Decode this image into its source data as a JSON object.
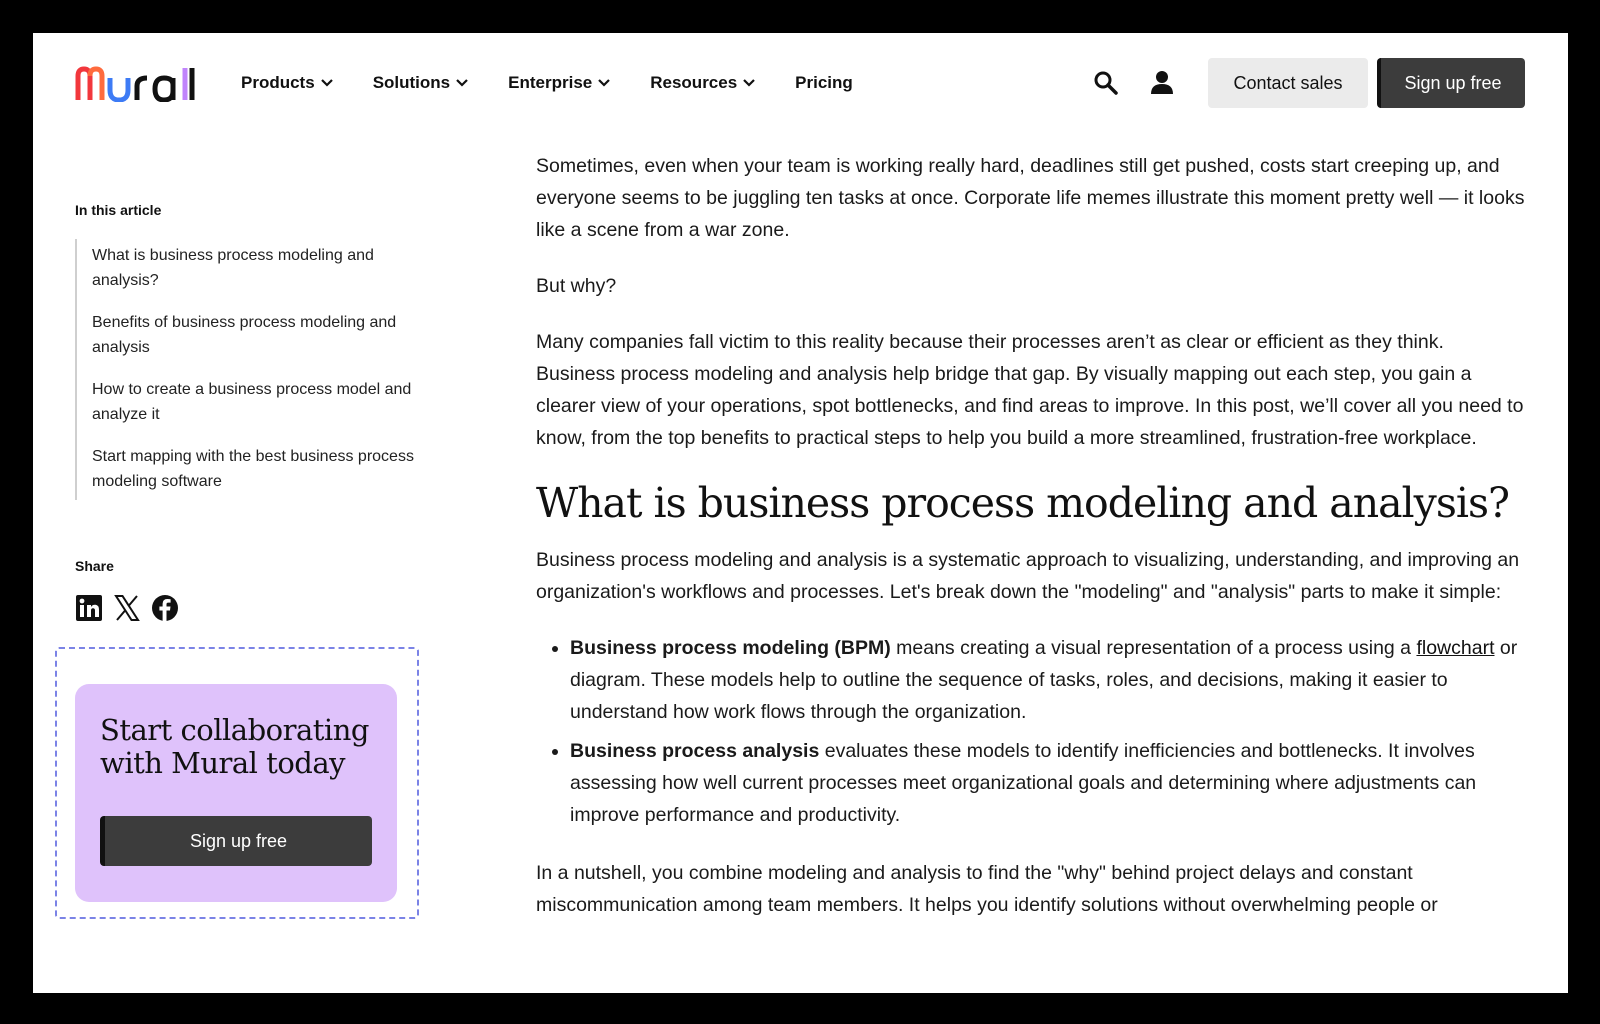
{
  "header": {
    "logo_text": "Mural",
    "nav": [
      {
        "label": "Products",
        "has_dropdown": true
      },
      {
        "label": "Solutions",
        "has_dropdown": true
      },
      {
        "label": "Enterprise",
        "has_dropdown": true
      },
      {
        "label": "Resources",
        "has_dropdown": true
      },
      {
        "label": "Pricing",
        "has_dropdown": false
      }
    ],
    "search_icon": "search-icon",
    "account_icon": "user-icon",
    "contact_label": "Contact sales",
    "signup_label": "Sign up free"
  },
  "sidebar": {
    "toc_title": "In this article",
    "toc_items": [
      "What is business process modeling and analysis?",
      "Benefits of business process modeling and analysis",
      "How to create a business process model and analyze it",
      "Start mapping with the best business process modeling software"
    ],
    "share_title": "Share",
    "share_icons": [
      "linkedin-icon",
      "x-icon",
      "facebook-icon"
    ],
    "cta": {
      "title": "Start collaborating with Mural today",
      "button_label": "Sign up free"
    }
  },
  "article": {
    "intro_1": "Sometimes, even when your team is working really hard, deadlines still get pushed, costs start creeping up, and everyone seems to be juggling ten tasks at once. Corporate life memes illustrate this moment pretty well — it looks like a scene from a war zone.",
    "intro_2": "But why?",
    "intro_3": "Many companies fall victim to this reality because their processes aren’t as clear or efficient as they think. Business process modeling and analysis help bridge that gap. By visually mapping out each step, you gain a clearer view of your operations, spot bottlenecks, and find areas to improve. In this post, we’ll cover all you need to know, from the top benefits to practical steps to help you build a more streamlined, frustration-free workplace.",
    "heading": "What is business process modeling and analysis?",
    "definition": "Business process modeling and analysis is a systematic approach to visualizing, understanding, and improving an organization's workflows and processes. Let's break down the \"modeling\" and \"analysis\" parts to make it simple:",
    "bullet_1_bold": "Business process modeling (BPM)",
    "bullet_1_text": " means creating a visual representation of a process using a ",
    "bullet_1_link": "flowchart",
    "bullet_1_rest": " or diagram. These models help to outline the sequence of tasks, roles, and decisions, making it easier to understand how work flows through the organization.",
    "bullet_2_bold": "Business process analysis",
    "bullet_2_text": " evaluates these models to identify inefficiencies and bottlenecks. It involves assessing how well current processes meet organizational goals and determining where adjustments can improve performance and productivity.",
    "nutshell": "In a nutshell, you combine modeling and analysis to find the \"why\" behind project delays and constant miscommunication among team members. It helps you identify solutions without overwhelming people or"
  },
  "colors": {
    "page_bg": "#ffffff",
    "frame": "#000000",
    "dark_button": "#3c3c3c",
    "light_button": "#ebebeb",
    "cta_bg": "#dfc2fb",
    "cta_border": "#7b83e6"
  }
}
